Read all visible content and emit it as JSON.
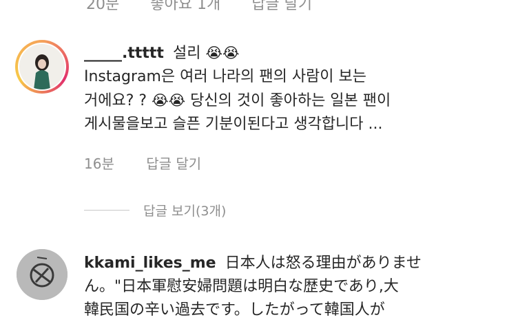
{
  "top_cutoff": {
    "time": "20분",
    "likes": "좋아요 1개",
    "reply": "답글 달기"
  },
  "comment1": {
    "username": "_____.ttttt",
    "name": "설리",
    "emoji": "😭😭",
    "line1": "Instagram은 여러 나라의 팬의 사람이 보는",
    "line2a": "거에요? ?",
    "line2_emoji": "😭😭",
    "line2b": "당신의 것이 좋아하는 일본 팬이",
    "line3": "게시물을보고 슬픈 기분이된다고 생각합니다 ...",
    "time": "16분",
    "reply": "답글 달기"
  },
  "view_replies": "답글 보기(3개)",
  "comment2": {
    "username": "kkami_likes_me",
    "line1": "日本人は怒る理由がありませ",
    "line2": "ん。\"日本軍慰安婦問題は明白な歴史であり,大",
    "line3": "韓民国の辛い過去です。したがって韓国人が"
  }
}
